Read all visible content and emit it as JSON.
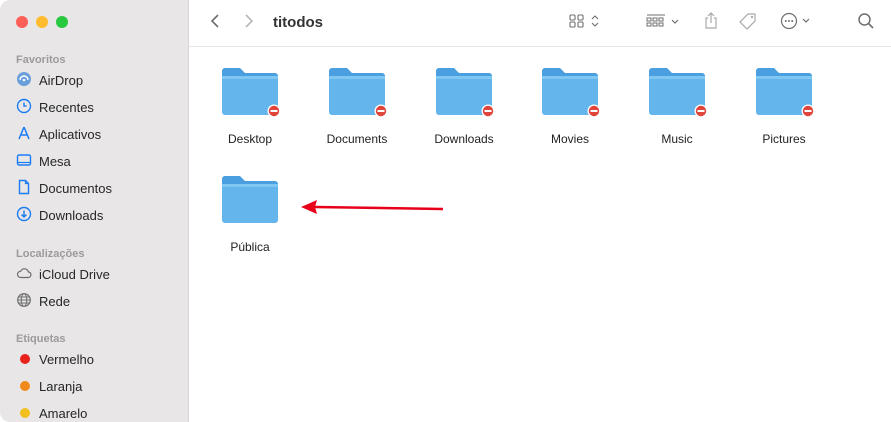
{
  "window": {
    "title": "titodos"
  },
  "sidebar": {
    "sections": [
      {
        "title": "Favoritos"
      },
      {
        "title": "Localizações"
      },
      {
        "title": "Etiquetas"
      }
    ],
    "favorites": [
      {
        "label": "AirDrop",
        "icon": "airdrop-icon"
      },
      {
        "label": "Recentes",
        "icon": "clock-icon"
      },
      {
        "label": "Aplicativos",
        "icon": "applications-icon"
      },
      {
        "label": "Mesa",
        "icon": "desktop-icon"
      },
      {
        "label": "Documentos",
        "icon": "document-icon"
      },
      {
        "label": "Downloads",
        "icon": "download-icon"
      }
    ],
    "locations": [
      {
        "label": "iCloud Drive",
        "icon": "cloud-icon"
      },
      {
        "label": "Rede",
        "icon": "network-icon"
      }
    ],
    "tags": [
      {
        "label": "Vermelho",
        "color": "#e6221b"
      },
      {
        "label": "Laranja",
        "color": "#f08a1c"
      },
      {
        "label": "Amarelo",
        "color": "#f2c01e"
      }
    ]
  },
  "toolbar": {
    "back_icon": "chevron-left-icon",
    "forward_icon": "chevron-right-icon",
    "view_icon": "grid-view-icon",
    "group_icon": "group-icon",
    "share_icon": "share-icon",
    "tag_icon": "tag-icon",
    "more_icon": "more-icon",
    "search_icon": "search-icon"
  },
  "folders": [
    {
      "label": "Desktop",
      "restricted": true
    },
    {
      "label": "Documents",
      "restricted": true
    },
    {
      "label": "Downloads",
      "restricted": true
    },
    {
      "label": "Movies",
      "restricted": true
    },
    {
      "label": "Music",
      "restricted": true
    },
    {
      "label": "Pictures",
      "restricted": true
    },
    {
      "label": "Pública",
      "restricted": false
    }
  ],
  "colors": {
    "accent": "#1a7cf5",
    "folder": "#63b5ec",
    "folder_dark": "#4a9fe0",
    "restricted_badge": "#e0453a",
    "annotation_arrow": "#e8001a"
  }
}
